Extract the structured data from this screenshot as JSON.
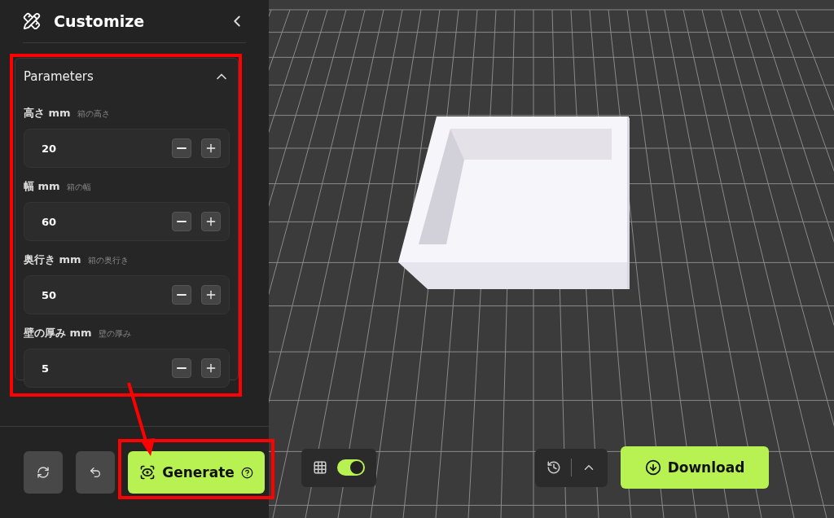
{
  "sidebar": {
    "title": "Customize",
    "section": {
      "title": "Parameters",
      "expanded": true,
      "params": [
        {
          "label": "高さ mm",
          "hint": "箱の高さ",
          "value": "20"
        },
        {
          "label": "幅 mm",
          "hint": "箱の幅",
          "value": "60"
        },
        {
          "label": "奥行き mm",
          "hint": "箱の奥行き",
          "value": "50"
        },
        {
          "label": "壁の厚み mm",
          "hint": "壁の厚み",
          "value": "5"
        }
      ]
    }
  },
  "actions": {
    "generate": "Generate"
  },
  "viewport": {
    "grid_on": true
  },
  "download": "Download"
}
